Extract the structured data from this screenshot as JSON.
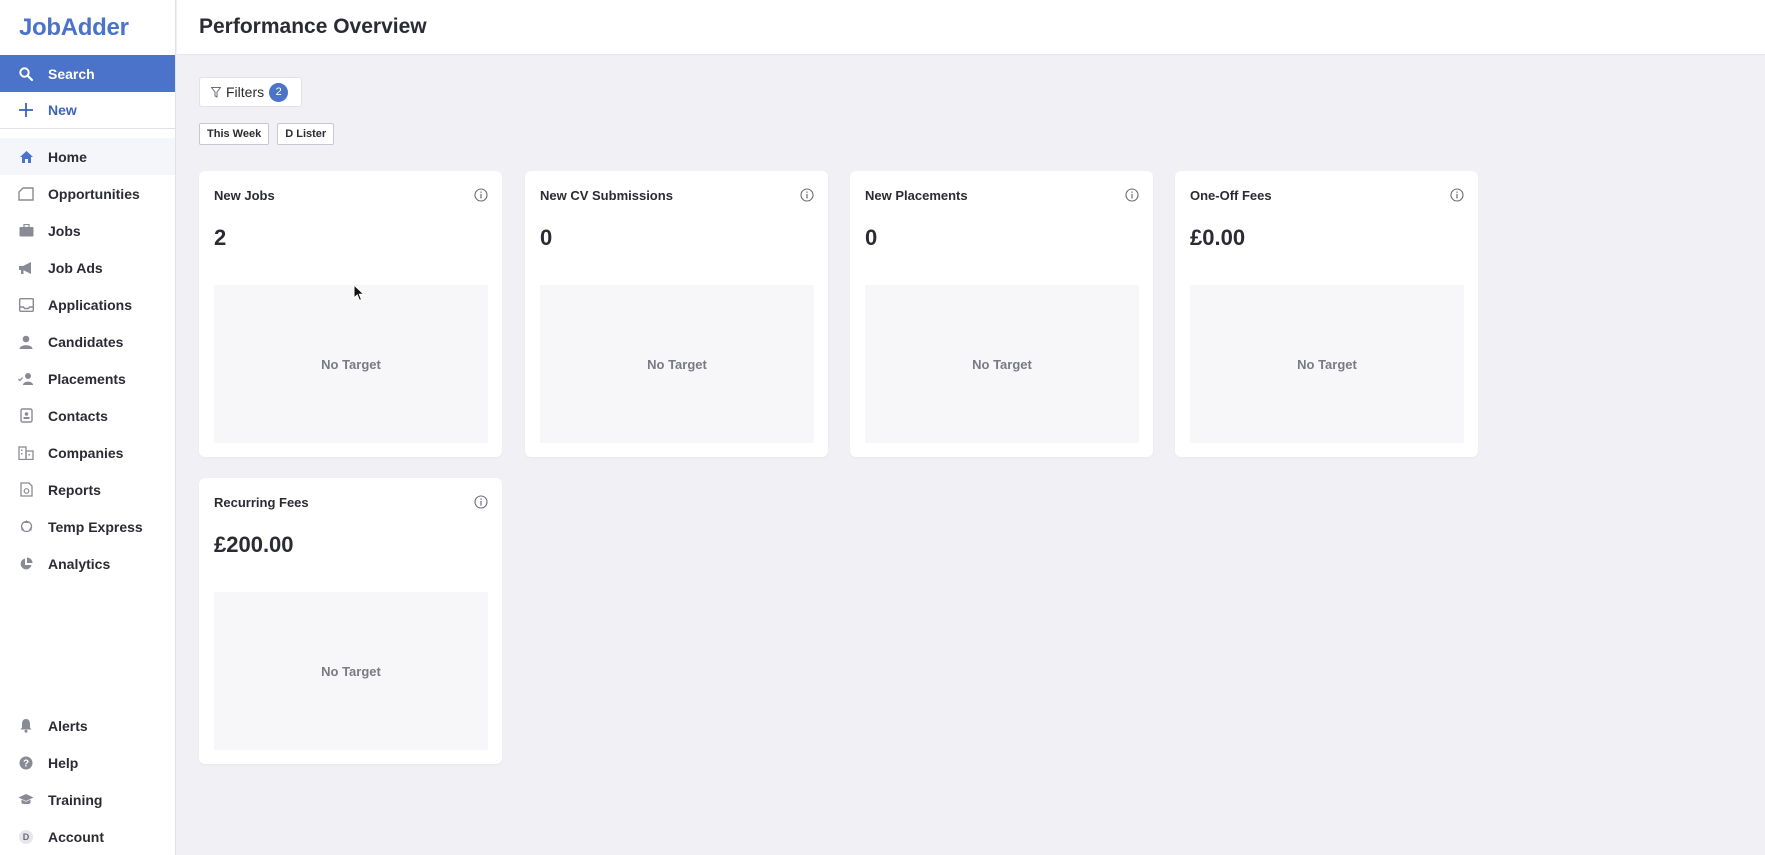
{
  "brand": {
    "logo_text": "JobAdder",
    "accent": "#4a73c9"
  },
  "sidebar": {
    "search_label": "Search",
    "new_label": "New",
    "items": [
      {
        "label": "Home",
        "icon": "home-icon"
      },
      {
        "label": "Opportunities",
        "icon": "opportunities-icon"
      },
      {
        "label": "Jobs",
        "icon": "briefcase-icon"
      },
      {
        "label": "Job Ads",
        "icon": "megaphone-icon"
      },
      {
        "label": "Applications",
        "icon": "inbox-icon"
      },
      {
        "label": "Candidates",
        "icon": "person-icon"
      },
      {
        "label": "Placements",
        "icon": "placement-icon"
      },
      {
        "label": "Contacts",
        "icon": "contact-card-icon"
      },
      {
        "label": "Companies",
        "icon": "building-icon"
      },
      {
        "label": "Reports",
        "icon": "report-icon"
      },
      {
        "label": "Temp Express",
        "icon": "temp-express-icon"
      },
      {
        "label": "Analytics",
        "icon": "pie-chart-icon"
      }
    ],
    "bottom_items": [
      {
        "label": "Alerts",
        "icon": "bell-icon"
      },
      {
        "label": "Help",
        "icon": "help-icon"
      },
      {
        "label": "Training",
        "icon": "graduation-cap-icon"
      },
      {
        "label": "Account",
        "icon": "account-avatar",
        "avatar_letter": "D"
      }
    ]
  },
  "header": {
    "title": "Performance Overview"
  },
  "filters": {
    "label": "Filters",
    "count": "2",
    "chips": [
      "This Week",
      "D Lister"
    ]
  },
  "cards": [
    {
      "title": "New Jobs",
      "value": "2",
      "target": "No Target"
    },
    {
      "title": "New CV Submissions",
      "value": "0",
      "target": "No Target"
    },
    {
      "title": "New Placements",
      "value": "0",
      "target": "No Target"
    },
    {
      "title": "One-Off Fees",
      "value": "£0.00",
      "target": "No Target"
    },
    {
      "title": "Recurring Fees",
      "value": "£200.00",
      "target": "No Target"
    }
  ]
}
